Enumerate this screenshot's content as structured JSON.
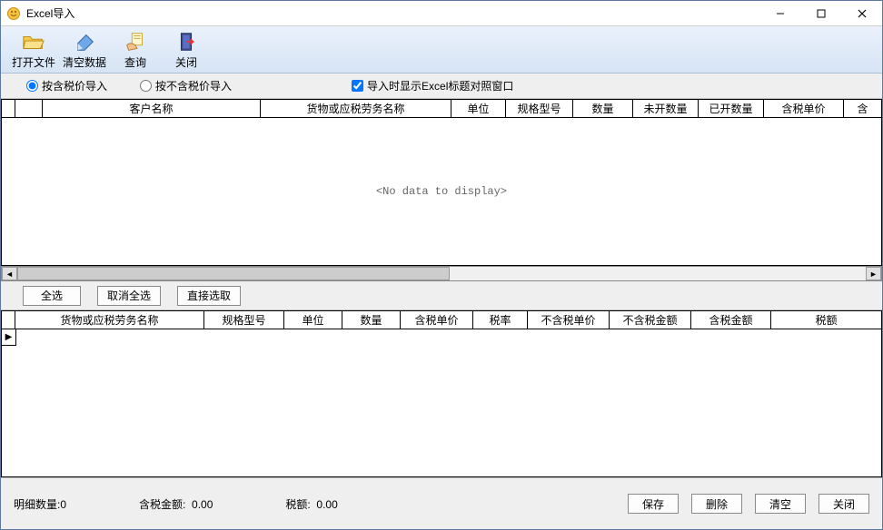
{
  "window": {
    "title": "Excel导入"
  },
  "toolbar": {
    "open_file": "打开文件",
    "clear_data": "清空数据",
    "query": "查询",
    "close": "关闭"
  },
  "options": {
    "radio_with_tax": "按含税价导入",
    "radio_without_tax": "按不含税价导入",
    "checkbox_show_title": "导入时显示Excel标题对照窗口"
  },
  "grid1": {
    "headers": [
      "",
      "",
      "客户名称",
      "货物或应税劳务名称",
      "单位",
      "规格型号",
      "数量",
      "未开数量",
      "已开数量",
      "含税单价",
      "含"
    ],
    "no_data": "<No data to display>"
  },
  "mid_buttons": {
    "select_all": "全选",
    "deselect_all": "取消全选",
    "direct_pick": "直接选取"
  },
  "grid2": {
    "headers": [
      "",
      "货物或应税劳务名称",
      "规格型号",
      "单位",
      "数量",
      "含税单价",
      "税率",
      "不含税单价",
      "不含税金额",
      "含税金额",
      "税额"
    ]
  },
  "footer": {
    "detail_count_label": "明细数量:",
    "detail_count_value": "0",
    "tax_amount_label": "含税金额:",
    "tax_amount_value": "0.00",
    "tax_label": "税额:",
    "tax_value": "0.00",
    "save": "保存",
    "delete": "删除",
    "clear": "清空",
    "close": "关闭"
  }
}
